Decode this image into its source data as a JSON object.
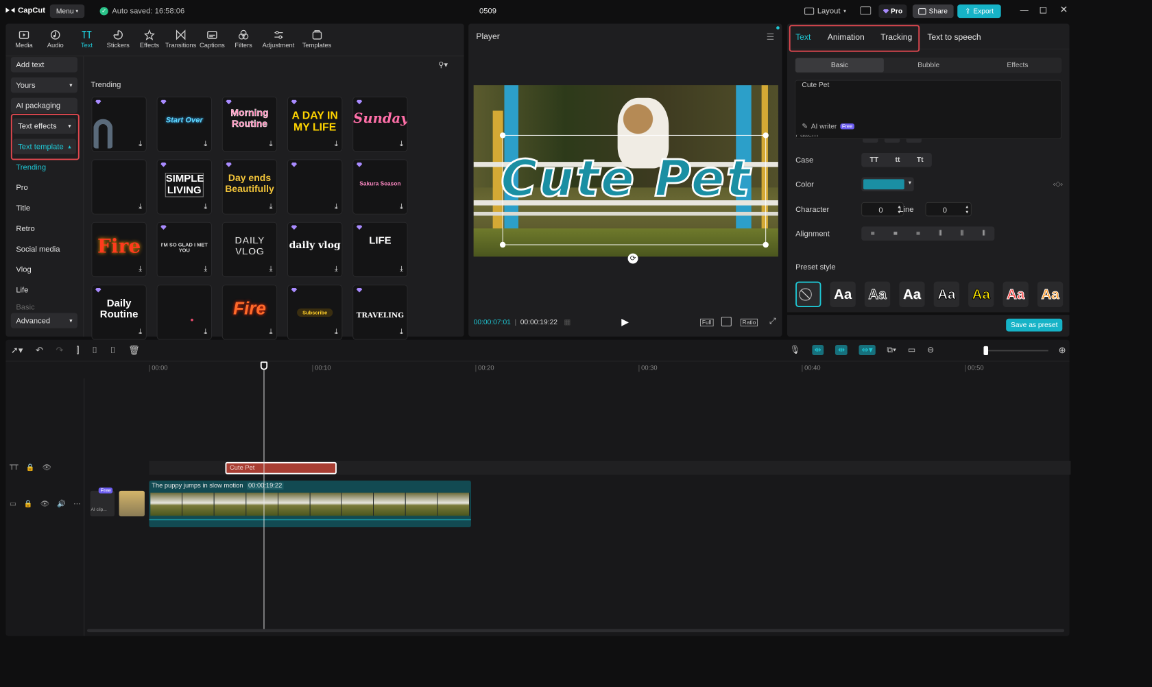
{
  "app": {
    "logo": "CapCut",
    "menu": "Menu",
    "autosave": "Auto saved: 16:58:06",
    "project": "0509",
    "layout": "Layout",
    "pro": "Pro",
    "share": "Share",
    "export": "Export"
  },
  "toolbar": [
    {
      "label": "Media",
      "icon": "media-icon"
    },
    {
      "label": "Audio",
      "icon": "audio-icon"
    },
    {
      "label": "Text",
      "icon": "text-icon"
    },
    {
      "label": "Stickers",
      "icon": "stickers-icon"
    },
    {
      "label": "Effects",
      "icon": "effects-icon"
    },
    {
      "label": "Transitions",
      "icon": "transitions-icon"
    },
    {
      "label": "Captions",
      "icon": "captions-icon"
    },
    {
      "label": "Filters",
      "icon": "filters-icon"
    },
    {
      "label": "Adjustment",
      "icon": "adjustment-icon"
    },
    {
      "label": "Templates",
      "icon": "templates-icon"
    }
  ],
  "left_menu": {
    "add_text": "Add text",
    "yours": "Yours",
    "ai_packaging": "AI packaging",
    "text_effects": "Text effects",
    "text_template": "Text template",
    "items": [
      "Trending",
      "Pro",
      "Title",
      "Retro",
      "Social media",
      "Vlog",
      "Life",
      "Basic"
    ],
    "advanced": "Advanced"
  },
  "gallery": {
    "section": "Trending",
    "cards": [
      {
        "text": "",
        "style": "blob"
      },
      {
        "text": "Start Over",
        "style": "neon-blue"
      },
      {
        "text": "Morning Routine",
        "style": "pink"
      },
      {
        "text": "A DAY IN MY LIFE",
        "style": "yellow"
      },
      {
        "text": "Sunday",
        "style": "pinkscript"
      },
      {
        "text": "",
        "style": "dark"
      },
      {
        "text": "SIMPLE LIVING",
        "style": "boxed"
      },
      {
        "text": "Day ends Beautifully",
        "style": "gold"
      },
      {
        "text": "",
        "style": "script"
      },
      {
        "text": "Sakura Season",
        "style": "pinksmall"
      },
      {
        "text": "Fire",
        "style": "fire"
      },
      {
        "text": "I'M SO GLAD I MET YOU",
        "style": "small"
      },
      {
        "text": "DAILY VLOG",
        "style": "bubble"
      },
      {
        "text": "daily vlog",
        "style": "white"
      },
      {
        "text": "LIFE",
        "style": "waves"
      },
      {
        "text": "Daily Routine",
        "style": "white2"
      },
      {
        "text": "",
        "style": "empty"
      },
      {
        "text": "Fire",
        "style": "neonfire"
      },
      {
        "text": "Subscribe",
        "style": "sub"
      },
      {
        "text": "TRAVELING",
        "style": "travel"
      }
    ]
  },
  "player": {
    "title": "Player",
    "overlay_text": "Cute Pet",
    "current_time": "00:00:07:01",
    "total_time": "00:00:19:22",
    "full": "Full",
    "ratio": "Ratio"
  },
  "right_panel": {
    "tabs": [
      "Text",
      "Animation",
      "Tracking",
      "Text to speech"
    ],
    "subtabs": [
      "Basic",
      "Bubble",
      "Effects"
    ],
    "text_value": "Cute Pet",
    "ai_writer": "AI writer",
    "free": "Free",
    "pattern": "Pattern",
    "case_label": "Case",
    "case_opts": [
      "TT",
      "tt",
      "Tt"
    ],
    "color_label": "Color",
    "color": "#1a8fa3",
    "character_label": "Character",
    "character_value": "0",
    "line_label": "Line",
    "line_value": "0",
    "alignment_label": "Alignment",
    "preset_label": "Preset style",
    "preset_sample": "Aa",
    "save_preset": "Save as preset"
  },
  "timeline": {
    "ruler": [
      "00:00",
      "00:10",
      "00:20",
      "00:30",
      "00:40",
      "00:50"
    ],
    "text_clip": "Cute Pet",
    "video_label": "The puppy jumps in slow motion",
    "video_duration": "00:00:19:22",
    "free": "Free",
    "ai_clip": "AI clip..."
  }
}
